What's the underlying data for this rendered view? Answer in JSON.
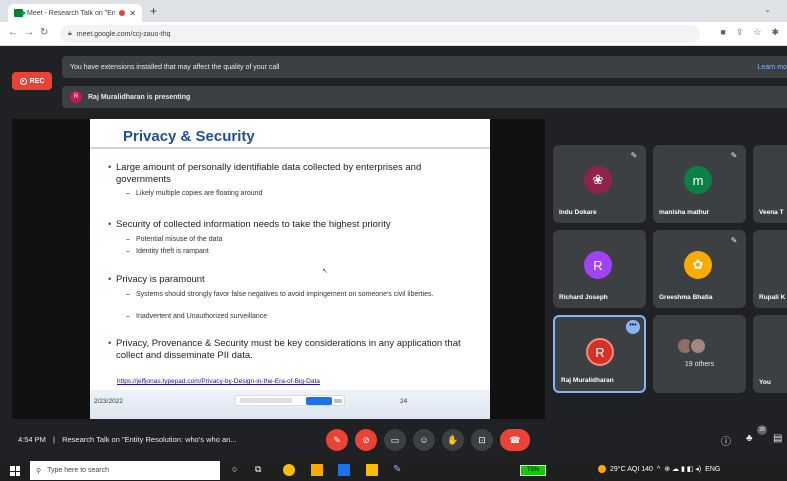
{
  "browser": {
    "tab_title": "Meet - Research Talk on \"En",
    "tab_close": "✕",
    "new_tab": "+",
    "url": "meet.google.com/ccj-zauo-thq"
  },
  "meet": {
    "rec_label": "REC",
    "extension_banner": "You have extensions installed that may affect the quality of your call",
    "learn_more": "Learn mo",
    "presenter_initial": "R",
    "presenting_text": "Raj Muralidharan is presenting"
  },
  "slide": {
    "title": "Privacy & Security",
    "bullets": [
      {
        "text": "Large amount of personally identifiable data collected by enterprises and governments",
        "subs": [
          "Likely multiple copies are floating around"
        ]
      },
      {
        "text": "Security of collected information needs to take the highest priority",
        "subs": [
          "Potential misuse of the data",
          "Identity theft is rampant"
        ]
      },
      {
        "text": "Privacy is paramount",
        "subs": [
          "Systems should strongly favor false negatives to avoid impingement on someone's civil liberties.",
          "Inadvertent and Unauthorized surveillance"
        ]
      },
      {
        "text": "Privacy, Provenance & Security must be key considerations in any application that collect and disseminate PII data.",
        "subs": []
      }
    ],
    "link": "https://jeffjonas.typepad.com/Privacy-by-Design-in-the-Era-of-Big-Data",
    "date": "2/23/2022",
    "page_number": "24"
  },
  "participants": [
    {
      "name": "Indu Dokare",
      "initial": "",
      "color": "#8e244d",
      "muted": true
    },
    {
      "name": "manisha mathur",
      "initial": "m",
      "color": "#0b8043",
      "muted": true
    },
    {
      "name": "Veena T",
      "initial": "",
      "color": "#5f6368",
      "muted": false
    },
    {
      "name": "Richard Joseph",
      "initial": "R",
      "color": "#a142f4",
      "muted": false
    },
    {
      "name": "Greeshma Bhatia",
      "initial": "",
      "color": "#f9ab00",
      "muted": true
    },
    {
      "name": "Rupali K",
      "initial": "",
      "color": "#5f6368",
      "muted": false
    },
    {
      "name": "Raj Muralidharan",
      "initial": "R",
      "color": "#d93025",
      "muted": false
    },
    {
      "name": "19 others",
      "initial": "",
      "color": "#3c4043",
      "muted": false
    },
    {
      "name": "You",
      "initial": "",
      "color": "#5f6368",
      "muted": false
    }
  ],
  "bottom_bar": {
    "time": "4:54 PM",
    "separator": "|",
    "meeting_title": "Research Talk on \"Entity Resolution: who's who an...",
    "participant_count": "28"
  },
  "taskbar": {
    "search_placeholder": "Type here to search",
    "battery": "73%",
    "weather": "29°C AQI 140",
    "language": "ENG"
  },
  "colors": {
    "meet_bg": "#202124",
    "tile_bg": "#3c4043",
    "rec_red": "#ea4335",
    "slide_title_blue": "#1f4e9e",
    "accent_blue": "#8ab4f8"
  }
}
